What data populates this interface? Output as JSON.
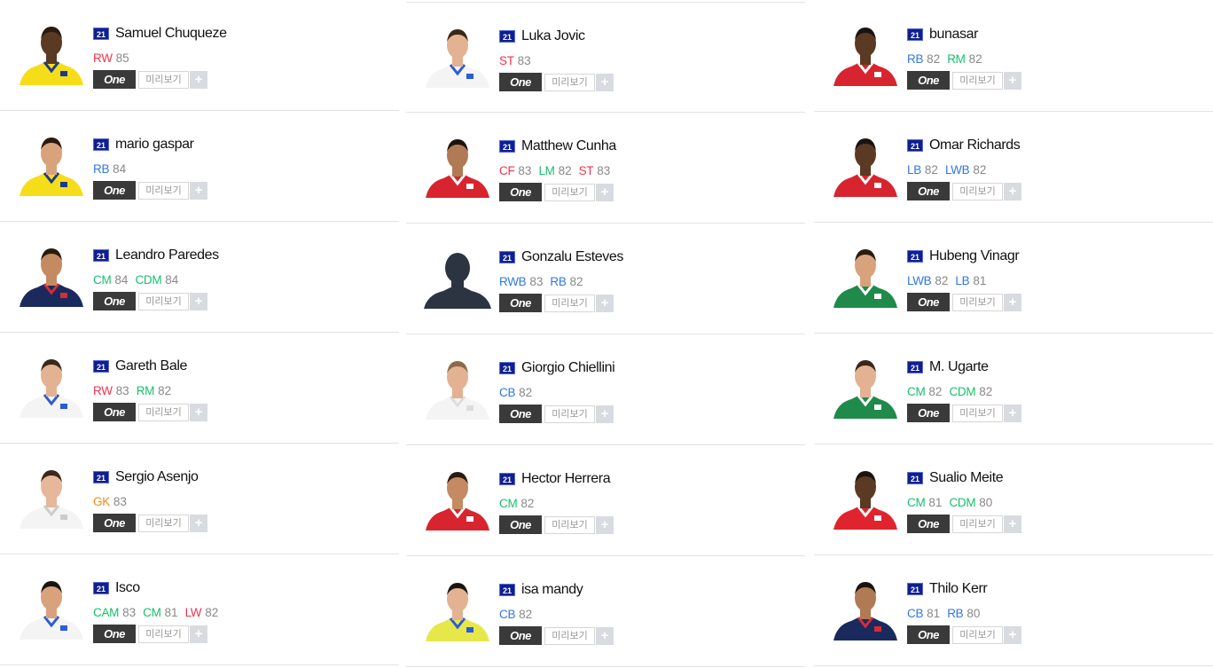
{
  "ui": {
    "one_label": "One",
    "preview_label": "미리보기",
    "plus_label": "+"
  },
  "position_colors": {
    "attack": "#f0334d",
    "mid": "#18c06a",
    "def": "#2f77e8",
    "gk": "#f28a18"
  },
  "columns": [
    {
      "players": [
        {
          "season": "21",
          "name": "Samuel Chuqueze",
          "kit": {
            "shirt": "#f6dd1a",
            "trim": "#1b3a8f",
            "skin": "#5a3a22",
            "hair": "#2a1a10"
          },
          "positions": [
            {
              "pos": "RW",
              "ovr": "85",
              "group": "attack"
            }
          ]
        },
        {
          "season": "21",
          "name": "mario gaspar",
          "kit": {
            "shirt": "#f6dd1a",
            "trim": "#1b3a8f",
            "skin": "#d8a27c",
            "hair": "#2a1a10"
          },
          "positions": [
            {
              "pos": "RB",
              "ovr": "84",
              "group": "def"
            }
          ]
        },
        {
          "season": "21",
          "name": "Leandro Paredes",
          "kit": {
            "shirt": "#1b2a5c",
            "trim": "#d82a3a",
            "skin": "#c48a62",
            "hair": "#2a1a10"
          },
          "positions": [
            {
              "pos": "CM",
              "ovr": "84",
              "group": "mid"
            },
            {
              "pos": "CDM",
              "ovr": "84",
              "group": "mid"
            }
          ]
        },
        {
          "season": "21",
          "name": "Gareth Bale",
          "kit": {
            "shirt": "#f4f4f4",
            "trim": "#2a5bd8",
            "skin": "#e2b293",
            "hair": "#3a2818"
          },
          "positions": [
            {
              "pos": "RW",
              "ovr": "83",
              "group": "attack"
            },
            {
              "pos": "RM",
              "ovr": "82",
              "group": "mid"
            }
          ]
        },
        {
          "season": "21",
          "name": "Sergio Asenjo",
          "kit": {
            "shirt": "#f4f4f4",
            "trim": "#cccccc",
            "skin": "#e6b79a",
            "hair": "#3a2818"
          },
          "positions": [
            {
              "pos": "GK",
              "ovr": "83",
              "group": "gk"
            }
          ]
        },
        {
          "season": "21",
          "name": "Isco",
          "kit": {
            "shirt": "#f4f4f4",
            "trim": "#2a5bd8",
            "skin": "#d8a27c",
            "hair": "#1a1410"
          },
          "positions": [
            {
              "pos": "CAM",
              "ovr": "83",
              "group": "mid"
            },
            {
              "pos": "CM",
              "ovr": "81",
              "group": "mid"
            },
            {
              "pos": "LW",
              "ovr": "82",
              "group": "attack"
            }
          ]
        }
      ]
    },
    {
      "players": [
        {
          "season": "21",
          "name": "Luka Jovic",
          "kit": {
            "shirt": "#f4f4f4",
            "trim": "#2a5bd8",
            "skin": "#e2b293",
            "hair": "#3a2818"
          },
          "positions": [
            {
              "pos": "ST",
              "ovr": "83",
              "group": "attack"
            }
          ]
        },
        {
          "season": "21",
          "name": "Matthew Cunha",
          "kit": {
            "shirt": "#d8242e",
            "trim": "#ffffff",
            "skin": "#b07a54",
            "hair": "#1a1410"
          },
          "positions": [
            {
              "pos": "CF",
              "ovr": "83",
              "group": "attack"
            },
            {
              "pos": "LM",
              "ovr": "82",
              "group": "mid"
            },
            {
              "pos": "ST",
              "ovr": "83",
              "group": "attack"
            }
          ]
        },
        {
          "season": "21",
          "name": "Gonzalu Esteves",
          "kit": {
            "shirt": "#2c3442",
            "trim": "#2c3442",
            "skin": "#2c3442",
            "hair": "#2c3442"
          },
          "positions": [
            {
              "pos": "RWB",
              "ovr": "83",
              "group": "def"
            },
            {
              "pos": "RB",
              "ovr": "82",
              "group": "def"
            }
          ]
        },
        {
          "season": "21",
          "name": "Giorgio Chiellini",
          "kit": {
            "shirt": "#f4f4f4",
            "trim": "#dddddd",
            "skin": "#e2b293",
            "hair": "#8a6a4a"
          },
          "positions": [
            {
              "pos": "CB",
              "ovr": "82",
              "group": "def"
            }
          ]
        },
        {
          "season": "21",
          "name": "Hector Herrera",
          "kit": {
            "shirt": "#d8242e",
            "trim": "#ffffff",
            "skin": "#c48a62",
            "hair": "#2a1a10"
          },
          "positions": [
            {
              "pos": "CM",
              "ovr": "82",
              "group": "mid"
            }
          ]
        },
        {
          "season": "21",
          "name": "isa mandy",
          "kit": {
            "shirt": "#e6e84a",
            "trim": "#2a5bd8",
            "skin": "#e2b293",
            "hair": "#1a1410"
          },
          "positions": [
            {
              "pos": "CB",
              "ovr": "82",
              "group": "def"
            }
          ]
        }
      ]
    },
    {
      "players": [
        {
          "season": "21",
          "name": "bunasar",
          "kit": {
            "shirt": "#d8242e",
            "trim": "#ffffff",
            "skin": "#5a3a22",
            "hair": "#1a1410"
          },
          "positions": [
            {
              "pos": "RB",
              "ovr": "82",
              "group": "def"
            },
            {
              "pos": "RM",
              "ovr": "82",
              "group": "mid"
            }
          ]
        },
        {
          "season": "21",
          "name": "Omar Richards",
          "kit": {
            "shirt": "#d8242e",
            "trim": "#ffffff",
            "skin": "#5a3a22",
            "hair": "#1a1410"
          },
          "positions": [
            {
              "pos": "LB",
              "ovr": "82",
              "group": "def"
            },
            {
              "pos": "LWB",
              "ovr": "82",
              "group": "def"
            }
          ]
        },
        {
          "season": "21",
          "name": "Hubeng Vinagr",
          "kit": {
            "shirt": "#1f8a4a",
            "trim": "#ffffff",
            "skin": "#d8a27c",
            "hair": "#2a1a10"
          },
          "positions": [
            {
              "pos": "LWB",
              "ovr": "82",
              "group": "def"
            },
            {
              "pos": "LB",
              "ovr": "81",
              "group": "def"
            }
          ]
        },
        {
          "season": "21",
          "name": "M. Ugarte",
          "kit": {
            "shirt": "#1f8a4a",
            "trim": "#ffffff",
            "skin": "#e2b293",
            "hair": "#3a2818"
          },
          "positions": [
            {
              "pos": "CM",
              "ovr": "82",
              "group": "mid"
            },
            {
              "pos": "CDM",
              "ovr": "82",
              "group": "mid"
            }
          ]
        },
        {
          "season": "21",
          "name": "Sualio Meite",
          "kit": {
            "shirt": "#e0242e",
            "trim": "#ffffff",
            "skin": "#5a3a22",
            "hair": "#1a1410"
          },
          "positions": [
            {
              "pos": "CM",
              "ovr": "81",
              "group": "mid"
            },
            {
              "pos": "CDM",
              "ovr": "80",
              "group": "mid"
            }
          ]
        },
        {
          "season": "21",
          "name": "Thilo Kerr",
          "kit": {
            "shirt": "#1b2a5c",
            "trim": "#d82a3a",
            "skin": "#b07a54",
            "hair": "#1a1410"
          },
          "positions": [
            {
              "pos": "CB",
              "ovr": "81",
              "group": "def"
            },
            {
              "pos": "RB",
              "ovr": "80",
              "group": "def"
            }
          ]
        }
      ]
    }
  ]
}
